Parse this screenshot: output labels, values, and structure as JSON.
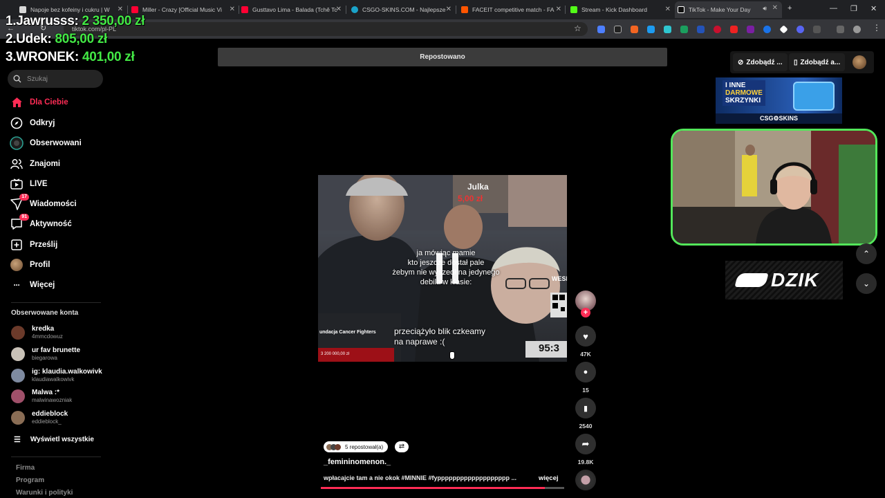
{
  "browser": {
    "tabs": [
      {
        "title": "Napoje bez kofeiny i cukru | W",
        "color": "#d8d8d8"
      },
      {
        "title": "Miller - Crazy [Official Music Vi",
        "color": "#ff0033"
      },
      {
        "title": "Gusttavo Lima - Balada (Tchê Tc",
        "color": "#ff0033"
      },
      {
        "title": "CSGO-SKINS.COM - Najlepsze",
        "color": "#1aa3c9"
      },
      {
        "title": "FACEIT competitive match - FA",
        "color": "#ff5500"
      },
      {
        "title": "Stream - Kick Dashboard",
        "color": "#53fc18"
      },
      {
        "title": "TikTok - Make Your Day",
        "color": "#111111"
      }
    ],
    "new_tab": "+",
    "url": "tiktok.com/pl-PL"
  },
  "overlay": {
    "leaderboard": [
      {
        "rank_name": "1.Jawrusss:",
        "amount": "2 350,00 zł"
      },
      {
        "rank_name": "2.Udek:",
        "amount": "805,00 zł"
      },
      {
        "rank_name": "3.WRONEK:",
        "amount": "401,00 zł"
      }
    ]
  },
  "sidebar": {
    "search_placeholder": "Szukaj",
    "nav": [
      {
        "label": "Dla Ciebie",
        "icon": "home-icon",
        "active": true
      },
      {
        "label": "Odkryj",
        "icon": "compass-icon"
      },
      {
        "label": "Obserwowani",
        "icon": "following-icon"
      },
      {
        "label": "Znajomi",
        "icon": "friends-icon"
      },
      {
        "label": "LIVE",
        "icon": "live-icon"
      },
      {
        "label": "Wiadomości",
        "icon": "messages-icon",
        "badge": "17"
      },
      {
        "label": "Aktywność",
        "icon": "activity-icon",
        "badge": "91"
      },
      {
        "label": "Prześlij",
        "icon": "upload-icon"
      },
      {
        "label": "Profil",
        "icon": "profile-icon"
      },
      {
        "label": "Więcej",
        "icon": "more-icon"
      }
    ],
    "following_header": "Obserwowane konta",
    "following": [
      {
        "name": "kredka",
        "handle": "4mmcdowuz",
        "color": "#6b3a2a"
      },
      {
        "name": "ur fav brunette",
        "handle": "biegarowa",
        "color": "#c9c2b8"
      },
      {
        "name": "ig: klaudia.walkowivk",
        "handle": "klaudiawalkowivk",
        "color": "#7e8aa0"
      },
      {
        "name": "Malwa :*",
        "handle": "malwinawozniak",
        "color": "#a0506a"
      },
      {
        "name": "eddieblock",
        "handle": "eddieblock_",
        "color": "#8a6d55"
      }
    ],
    "show_all": "Wyświetl wszystkie",
    "footer": [
      "Firma",
      "Program",
      "Warunki i polityki"
    ]
  },
  "video": {
    "reposted_banner": "Repostowano",
    "overlay_name": "Julka",
    "overlay_amount": "5,00 zł",
    "subtitle_top": [
      "ja mówiąc mamie",
      "kto jeszcze dostał pale",
      "żebym nie wyszedł na jedynego",
      "debila w klasie:"
    ],
    "subtitle_bottom": [
      "przeciążyło blik czkeamy",
      "na naprawe :("
    ],
    "timer": "95:3",
    "charity_label": "undacja Cancer Fighters",
    "charity_amount": "3 200 000,00 zł",
    "side_text": "WESE",
    "reposted_by": "5 repostował(a)",
    "author": "_femininomenon._",
    "caption": "wpłacajcie tam a nie okok #MINNIE #fyppppppppppppppppppp ...",
    "more": "więcej",
    "progress": 0.92
  },
  "actions": {
    "likes": "47K",
    "comments": "15",
    "saves": "2540",
    "shares": "19.8K"
  },
  "right": {
    "get_coins": "Zdobądź ...",
    "get_app": "Zdobądź a...",
    "csg_banner": [
      "I INNE",
      "DARMOWE",
      "SKRZYNKI"
    ],
    "csg_brand": "CSG⚙SKINS",
    "dzik": "DZIK"
  }
}
